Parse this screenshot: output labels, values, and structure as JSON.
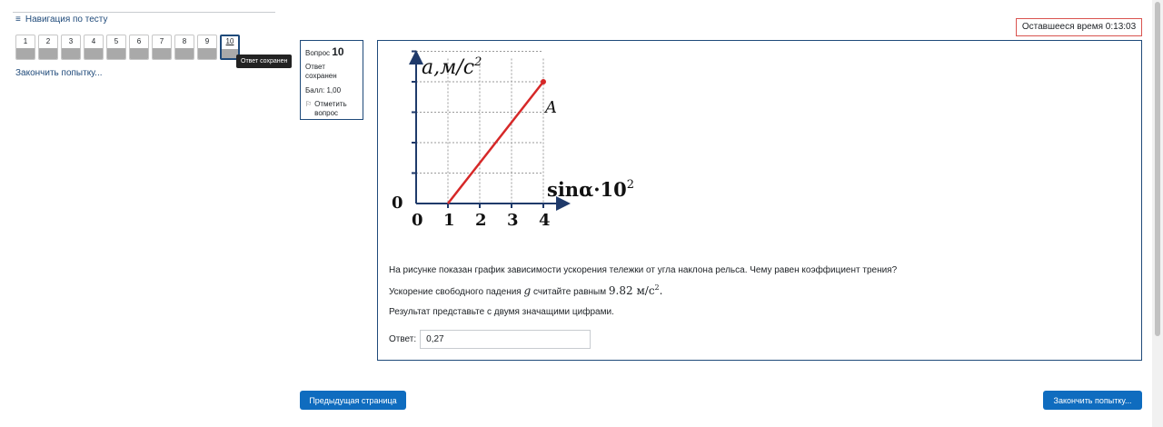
{
  "navigation": {
    "title": "Навигация по тесту",
    "questions": [
      "1",
      "2",
      "3",
      "4",
      "5",
      "6",
      "7",
      "8",
      "9",
      "10"
    ],
    "current": "10",
    "tooltip": "Ответ сохранен",
    "finish_link": "Закончить попытку..."
  },
  "timer": {
    "text": "Оставшееся время 0:13:03"
  },
  "question_info": {
    "label": "Вопрос",
    "number": "10",
    "state": "Ответ сохранен",
    "grade": "Балл: 1,00",
    "flag": "Отметить вопрос"
  },
  "graph": {
    "y_label": "a,м/с",
    "y_label_exp": "2",
    "x_label": "sinα·10",
    "x_label_exp": "2",
    "point_label": "A",
    "origin_y": "0",
    "x_ticks": [
      "0",
      "1",
      "2",
      "3",
      "4"
    ],
    "line_color": "#d62828"
  },
  "chart_data": {
    "type": "line",
    "title": "",
    "xlabel": "sinα·10²",
    "ylabel": "a,м/с²",
    "x": [
      1,
      4
    ],
    "series": [
      {
        "values": [
          0,
          4
        ]
      }
    ],
    "xlim": [
      0,
      4
    ],
    "ylim": [
      0,
      5
    ],
    "grid": true
  },
  "question": {
    "text1": "На рисунке показан график зависимости ускорения тележки от угла наклона рельса. Чему равен коэффициент трения?",
    "text2_prefix": "Ускорение свободного падения",
    "text2_var": "g",
    "text2_mid": "считайте равным",
    "text2_value": "9.82",
    "text2_unit": "м/с",
    "text2_unit_exp": "2",
    "text2_suffix": ".",
    "text3": "Результат представьте с двумя значащими цифрами.",
    "answer_label": "Ответ:",
    "answer_value": "0,27"
  },
  "buttons": {
    "prev": "Предыдущая страница",
    "finish": "Закончить попытку..."
  },
  "colors": {
    "accent": "#0f6cbf",
    "nav_text": "#1f4a7a",
    "timer_border": "#d9534f"
  }
}
